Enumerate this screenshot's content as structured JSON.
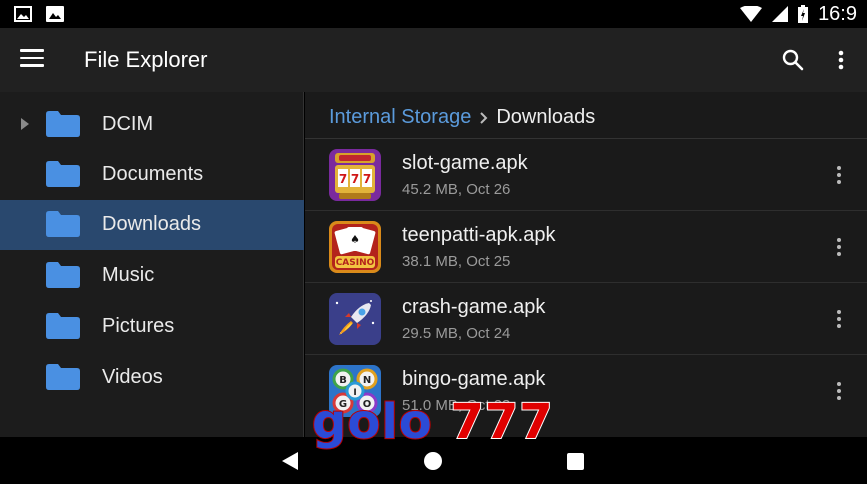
{
  "status_bar": {
    "time": "16:9"
  },
  "app_bar": {
    "title": "File Explorer"
  },
  "sidebar": {
    "items": [
      {
        "label": "DCIM",
        "selected": false,
        "expandable": true
      },
      {
        "label": "Documents",
        "selected": false,
        "expandable": false
      },
      {
        "label": "Downloads",
        "selected": true,
        "expandable": false
      },
      {
        "label": "Music",
        "selected": false,
        "expandable": false
      },
      {
        "label": "Pictures",
        "selected": false,
        "expandable": false
      },
      {
        "label": "Videos",
        "selected": false,
        "expandable": false
      }
    ]
  },
  "breadcrumb": {
    "root": "Internal Storage",
    "current": "Downloads"
  },
  "files": [
    {
      "name": "slot-game.apk",
      "meta": "45.2 MB, Oct 26",
      "icon": "slot-machine-icon"
    },
    {
      "name": "teenpatti-apk.apk",
      "meta": "38.1 MB, Oct 25",
      "icon": "casino-cards-icon"
    },
    {
      "name": "crash-game.apk",
      "meta": "29.5 MB, Oct 24",
      "icon": "rocket-icon"
    },
    {
      "name": "bingo-game.apk",
      "meta": "51.0 MB, Oct 23",
      "icon": "bingo-balls-icon"
    }
  ],
  "watermark": {
    "part1": "golo",
    "part2": "777"
  },
  "colors": {
    "accent": "#5b9bdc",
    "selected_bg": "#29486e",
    "folder": "#4a90e2"
  }
}
